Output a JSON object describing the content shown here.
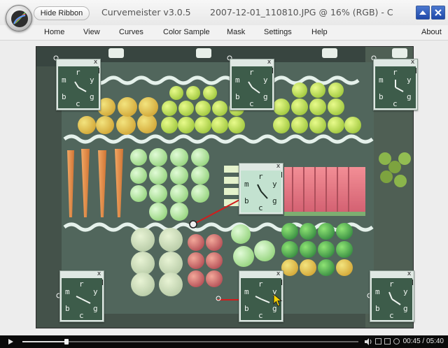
{
  "app": {
    "name": "Curvemeister v3.0.5",
    "document": "2007-12-01_110810.JPG @ 16% (RGB) - C..."
  },
  "ribbon": {
    "toggle_label": "Hide Ribbon"
  },
  "menu": {
    "items": [
      {
        "label": "Home"
      },
      {
        "label": "View"
      },
      {
        "label": "Curves"
      },
      {
        "label": "Color Sample"
      },
      {
        "label": "Mask"
      },
      {
        "label": "Settings"
      },
      {
        "label": "Help"
      },
      {
        "label": "About"
      }
    ]
  },
  "color_samplers": [
    {
      "letters": [
        "m",
        "r",
        "y",
        "b",
        "c",
        "g"
      ],
      "close": "x"
    },
    {
      "letters": [
        "m",
        "r",
        "y",
        "b",
        "c",
        "g"
      ],
      "close": "x"
    },
    {
      "letters": [
        "m",
        "r",
        "y",
        "b",
        "c",
        "g"
      ],
      "close": "x"
    },
    {
      "letters": [
        "m",
        "r",
        "y",
        "b",
        "c",
        "g"
      ],
      "close": "x"
    },
    {
      "letters": [
        "m",
        "r",
        "y",
        "b",
        "c",
        "g"
      ],
      "close": "x"
    },
    {
      "letters": [
        "m",
        "r",
        "y",
        "b",
        "c",
        "g"
      ],
      "close": "x"
    },
    {
      "letters": [
        "m",
        "r",
        "y",
        "b",
        "c",
        "g"
      ],
      "close": "x"
    }
  ],
  "player": {
    "timecode": "00:45 / 05:40",
    "progress": 0.132
  },
  "colors": {
    "title_button": "#2f5fbe",
    "clock_face_dark": "#3d5c4a",
    "clock_face_light": "#c3e2d0",
    "curve_line": "#d31c1c"
  }
}
